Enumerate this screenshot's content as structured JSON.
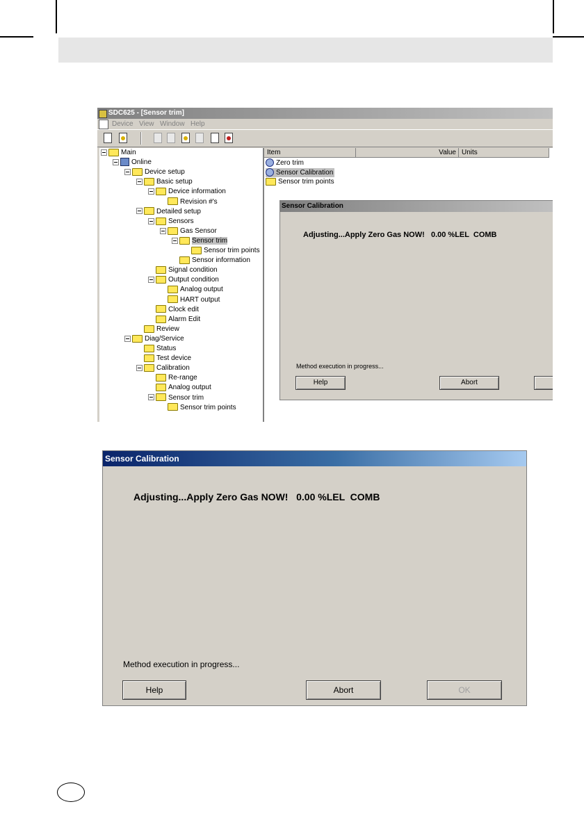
{
  "app": {
    "title": "SDC625 - [Sensor trim]",
    "menu": [
      "Device",
      "View",
      "Window",
      "Help"
    ]
  },
  "tree": [
    {
      "label": "Main",
      "depth": 0
    },
    {
      "label": "Online",
      "depth": 1
    },
    {
      "label": "Device setup",
      "depth": 2
    },
    {
      "label": "Basic setup",
      "depth": 3
    },
    {
      "label": "Device information",
      "depth": 4
    },
    {
      "label": "Revision #'s",
      "depth": 5
    },
    {
      "label": "Detailed setup",
      "depth": 3
    },
    {
      "label": "Sensors",
      "depth": 4
    },
    {
      "label": "Gas Sensor",
      "depth": 5
    },
    {
      "label": "Sensor trim",
      "depth": 6,
      "selected": true
    },
    {
      "label": "Sensor trim points",
      "depth": 7
    },
    {
      "label": "Sensor information",
      "depth": 6
    },
    {
      "label": "Signal condition",
      "depth": 4
    },
    {
      "label": "Output condition",
      "depth": 4
    },
    {
      "label": "Analog output",
      "depth": 5
    },
    {
      "label": "HART output",
      "depth": 5
    },
    {
      "label": "Clock edit",
      "depth": 4
    },
    {
      "label": "Alarm Edit",
      "depth": 4
    },
    {
      "label": "Review",
      "depth": 3
    },
    {
      "label": "Diag/Service",
      "depth": 2
    },
    {
      "label": "Status",
      "depth": 3
    },
    {
      "label": "Test device",
      "depth": 3
    },
    {
      "label": "Calibration",
      "depth": 3
    },
    {
      "label": "Re-range",
      "depth": 4
    },
    {
      "label": "Analog output",
      "depth": 4
    },
    {
      "label": "Sensor trim",
      "depth": 4
    },
    {
      "label": "Sensor trim points",
      "depth": 5
    }
  ],
  "list": {
    "columns": [
      "Item",
      "Value",
      "Units"
    ],
    "items": [
      {
        "label": "Zero trim",
        "icon": "method-icon"
      },
      {
        "label": "Sensor Calibration",
        "icon": "method-icon",
        "selected": true
      },
      {
        "label": "Sensor trim points",
        "icon": "folder-icon"
      }
    ]
  },
  "dialog": {
    "title": "Sensor Calibration",
    "message": "Adjusting...Apply Zero Gas NOW!   0.00 %LEL  COMB",
    "status": "Method execution in progress...",
    "buttons": {
      "help": "Help",
      "abort": "Abort",
      "ok": "OK"
    }
  },
  "colors": {
    "folder": "#ffe85a",
    "title_gradient_start": "#0a246a",
    "title_gradient_end": "#a6caf0",
    "dialog_bg": "#d4d0c8"
  }
}
